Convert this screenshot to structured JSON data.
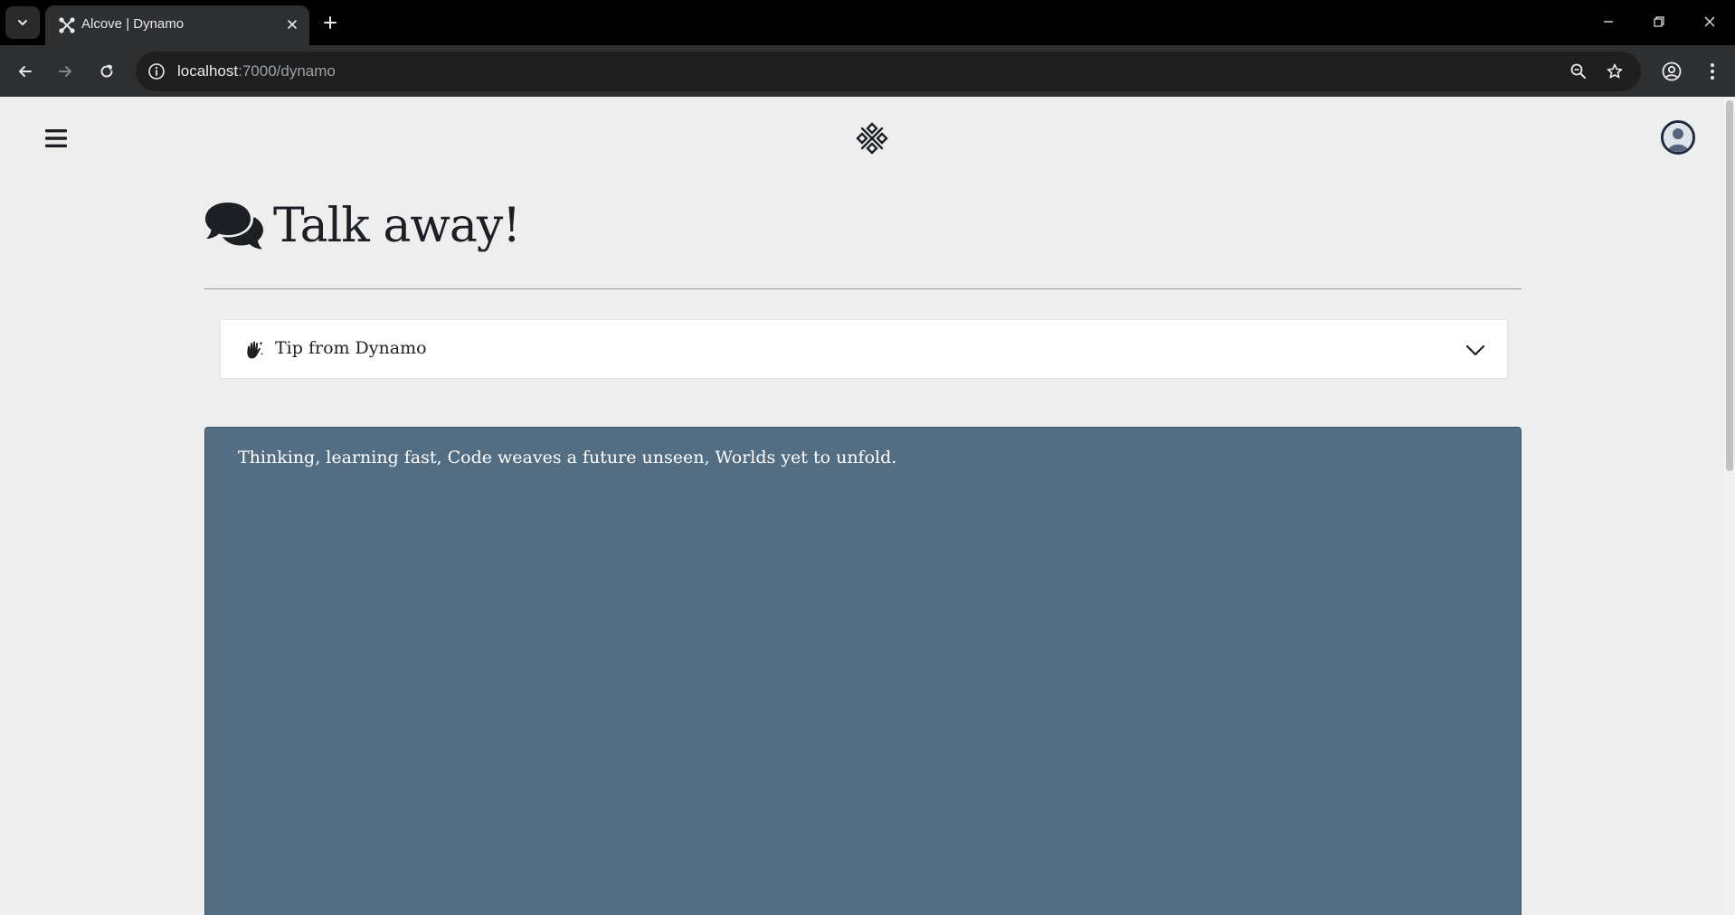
{
  "browser": {
    "tab_title": "Alcove | Dynamo",
    "url_host": "localhost",
    "url_path": ":7000/dynamo"
  },
  "page": {
    "title": "Talk away!",
    "tip": {
      "label": "Tip from Dynamo"
    },
    "chat": {
      "message": "Thinking, learning fast, Code weaves a future unseen, Worlds yet to unfold."
    }
  },
  "colors": {
    "page_bg": "#eeeeee",
    "chat_panel_bg": "#536e83",
    "heading": "#1c1f24"
  },
  "icons": {
    "heading": "comments-icon",
    "tip": "hand-sparkle-icon",
    "menu": "hamburger-icon",
    "logo": "alcove-logo-icon"
  }
}
